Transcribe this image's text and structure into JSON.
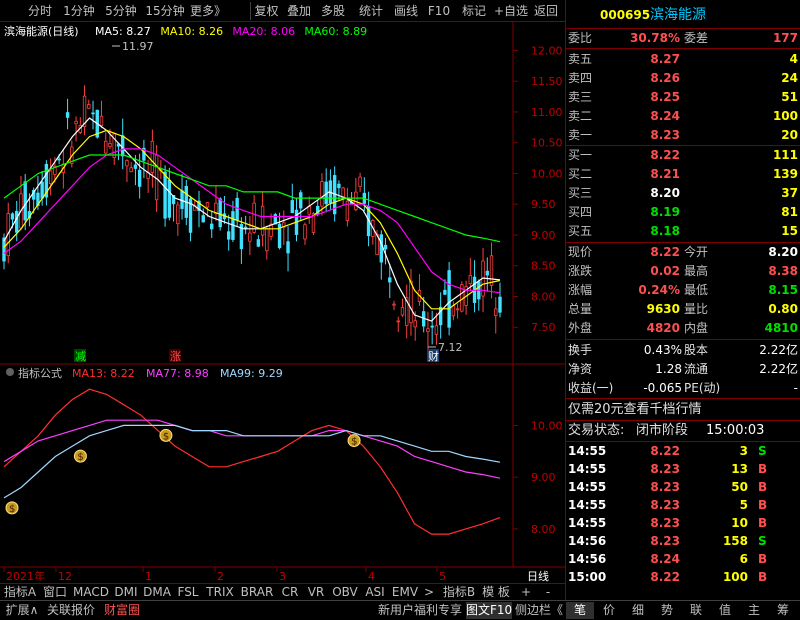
{
  "toolbar": {
    "left_items": [
      "分时",
      "1分钟",
      "5分钟",
      "15分钟",
      "更多》"
    ],
    "right_items": [
      "复权",
      "叠加",
      "多股",
      "统计",
      "画线",
      "F10",
      "标记",
      "+自选",
      "返回"
    ]
  },
  "main_chart": {
    "stock_label": "滨海能源(日线)",
    "ma_labels": [
      {
        "text": "MA5: 8.27",
        "color": "#ffffff"
      },
      {
        "text": "MA10: 8.26",
        "color": "#ffff00"
      },
      {
        "text": "MA20: 8.06",
        "color": "#ff00ff"
      },
      {
        "text": "MA60: 8.89",
        "color": "#00ff00"
      }
    ],
    "high_marker": "11.97",
    "low_marker": "7.12",
    "signal_down_text": "减",
    "signal_up_text": "涨",
    "signal_money_text": "财"
  },
  "indicator": {
    "name": "指标公式",
    "labels": [
      {
        "text": "MA13: 8.22",
        "color": "#ff3030"
      },
      {
        "text": "MA77: 8.98",
        "color": "#ff40ff"
      },
      {
        "text": "MA99: 9.29",
        "color": "#a0d8ff"
      }
    ],
    "money_icon": "$"
  },
  "time_axis": {
    "labels": [
      "2021年",
      "12",
      "1",
      "2",
      "3",
      "4",
      "5"
    ],
    "period_button": "日线"
  },
  "chart_data": [
    {
      "type": "line",
      "title": "",
      "y_axis_ticks": [
        "12.00",
        "11.50",
        "11.00",
        "10.50",
        "10.00",
        "9.50",
        "9.00",
        "8.50",
        "8.00",
        "7.50"
      ],
      "ylim": [
        7.0,
        12.3
      ],
      "series": [
        {
          "name": "MA5",
          "color": "#ffffff",
          "values": [
            8.9,
            9.4,
            9.8,
            10.2,
            10.6,
            10.9,
            10.7,
            10.4,
            10.1,
            9.9,
            9.6,
            9.5,
            9.3,
            9.2,
            9.1,
            9.1,
            9.2,
            9.3,
            9.5,
            9.7,
            9.6,
            9.4,
            8.9,
            8.2,
            7.7,
            7.6,
            7.9,
            8.1,
            8.3,
            8.27
          ]
        },
        {
          "name": "MA10",
          "color": "#ffff00",
          "values": [
            8.8,
            9.1,
            9.5,
            9.9,
            10.3,
            10.6,
            10.7,
            10.6,
            10.4,
            10.1,
            9.8,
            9.6,
            9.4,
            9.3,
            9.2,
            9.1,
            9.1,
            9.2,
            9.3,
            9.5,
            9.6,
            9.5,
            9.2,
            8.7,
            8.1,
            7.8,
            7.8,
            8.0,
            8.2,
            8.26
          ]
        },
        {
          "name": "MA20",
          "color": "#ff00ff",
          "values": [
            8.7,
            8.9,
            9.2,
            9.5,
            9.8,
            10.1,
            10.3,
            10.4,
            10.4,
            10.3,
            10.1,
            9.9,
            9.7,
            9.5,
            9.4,
            9.3,
            9.3,
            9.3,
            9.3,
            9.4,
            9.5,
            9.5,
            9.4,
            9.2,
            8.8,
            8.4,
            8.2,
            8.1,
            8.1,
            8.06
          ]
        },
        {
          "name": "MA60",
          "color": "#00ff00",
          "values": [
            9.6,
            9.8,
            10.0,
            10.1,
            10.2,
            10.3,
            10.3,
            10.3,
            10.2,
            10.1,
            10.0,
            9.9,
            9.8,
            9.8,
            9.7,
            9.7,
            9.7,
            9.6,
            9.6,
            9.6,
            9.6,
            9.6,
            9.5,
            9.4,
            9.3,
            9.2,
            9.1,
            9.0,
            8.95,
            8.89
          ]
        }
      ]
    },
    {
      "type": "line",
      "title": "",
      "y_axis_ticks": [
        "10.00",
        "9.00",
        "8.00"
      ],
      "ylim": [
        7.4,
        10.8
      ],
      "series": [
        {
          "name": "MA13",
          "color": "#ff3030",
          "values": [
            9.2,
            9.5,
            9.8,
            10.2,
            10.5,
            10.7,
            10.6,
            10.4,
            10.2,
            9.9,
            9.6,
            9.4,
            9.2,
            9.2,
            9.3,
            9.4,
            9.5,
            9.7,
            9.9,
            10.0,
            9.9,
            9.6,
            9.2,
            8.7,
            8.1,
            7.9,
            7.9,
            8.0,
            8.1,
            8.22
          ]
        },
        {
          "name": "MA77",
          "color": "#ff40ff",
          "values": [
            9.3,
            9.5,
            9.7,
            9.8,
            9.9,
            10.0,
            10.1,
            10.1,
            10.1,
            10.1,
            10.0,
            9.9,
            9.9,
            9.8,
            9.8,
            9.8,
            9.8,
            9.8,
            9.8,
            9.9,
            9.9,
            9.8,
            9.7,
            9.6,
            9.4,
            9.3,
            9.2,
            9.1,
            9.05,
            8.98
          ]
        },
        {
          "name": "MA99",
          "color": "#a0d8ff",
          "values": [
            8.6,
            8.8,
            9.1,
            9.4,
            9.6,
            9.8,
            9.9,
            10.0,
            10.0,
            10.0,
            10.0,
            9.9,
            9.9,
            9.9,
            9.8,
            9.8,
            9.8,
            9.8,
            9.8,
            9.8,
            9.9,
            9.8,
            9.8,
            9.7,
            9.6,
            9.5,
            9.5,
            9.4,
            9.35,
            9.29
          ]
        }
      ]
    }
  ],
  "quote": {
    "code": "000695",
    "name": "滨海能源",
    "weibi_label": "委比",
    "weibi": "30.78%",
    "weicha_label": "委差",
    "weicha": "177",
    "sells": [
      {
        "label": "卖五",
        "price": "8.27",
        "vol": "4"
      },
      {
        "label": "卖四",
        "price": "8.26",
        "vol": "24"
      },
      {
        "label": "卖三",
        "price": "8.25",
        "vol": "51"
      },
      {
        "label": "卖二",
        "price": "8.24",
        "vol": "100"
      },
      {
        "label": "卖一",
        "price": "8.23",
        "vol": "20"
      }
    ],
    "buys": [
      {
        "label": "买一",
        "price": "8.22",
        "vol": "111"
      },
      {
        "label": "买二",
        "price": "8.21",
        "vol": "139"
      },
      {
        "label": "买三",
        "price": "8.20",
        "vol": "37"
      },
      {
        "label": "买四",
        "price": "8.19",
        "vol": "81"
      },
      {
        "label": "买五",
        "price": "8.18",
        "vol": "15"
      }
    ],
    "stats": [
      {
        "l1": "现价",
        "v1": "8.22",
        "l2": "今开",
        "v2": "8.20"
      },
      {
        "l1": "涨跌",
        "v1": "0.02",
        "l2": "最高",
        "v2": "8.38"
      },
      {
        "l1": "涨幅",
        "v1": "0.24%",
        "l2": "最低",
        "v2": "8.15"
      },
      {
        "l1": "总量",
        "v1": "9630",
        "l2": "量比",
        "v2": "0.80"
      },
      {
        "l1": "外盘",
        "v1": "4820",
        "l2": "内盘",
        "v2": "4810"
      }
    ],
    "fin": [
      {
        "l1": "换手",
        "v1": "0.43%",
        "l2": "股本",
        "v2": "2.22亿"
      },
      {
        "l1": "净资",
        "v1": "1.28",
        "l2": "流通",
        "v2": "2.22亿"
      },
      {
        "l1": "收益(一)",
        "v1": "-0.065",
        "l2": "PE(动)",
        "v2": "-"
      }
    ],
    "promo": "仅需20元查看千档行情",
    "status_label": "交易状态:",
    "status_value": "闭市阶段",
    "status_time": "15:00:03"
  },
  "ticks": [
    {
      "t": "14:55",
      "p": "8.22",
      "v": "3",
      "s": "S"
    },
    {
      "t": "14:55",
      "p": "8.23",
      "v": "13",
      "s": "B"
    },
    {
      "t": "14:55",
      "p": "8.23",
      "v": "50",
      "s": "B"
    },
    {
      "t": "14:55",
      "p": "8.23",
      "v": "5",
      "s": "B"
    },
    {
      "t": "14:55",
      "p": "8.23",
      "v": "10",
      "s": "B"
    },
    {
      "t": "14:56",
      "p": "8.23",
      "v": "158",
      "s": "S"
    },
    {
      "t": "14:56",
      "p": "8.24",
      "v": "6",
      "s": "B"
    },
    {
      "t": "15:00",
      "p": "8.22",
      "v": "100",
      "s": "B"
    }
  ],
  "indicator_bar": {
    "items": [
      "指标A",
      "窗口",
      "MACD",
      "DMI",
      "DMA",
      "FSL",
      "TRIX",
      "BRAR",
      "CR",
      "VR",
      "OBV",
      "ASI",
      "EMV",
      ">",
      "指标B",
      "模 板",
      "+",
      "-"
    ]
  },
  "bottom_bar": {
    "left_items": [
      "扩展∧",
      "关联报价",
      "财富圈"
    ],
    "right_items": [
      "新用户福利专享",
      "图文F10",
      "侧边栏《"
    ],
    "side_tabs": [
      "笔",
      "价",
      "细",
      "势",
      "联",
      "值",
      "主",
      "筹"
    ]
  }
}
